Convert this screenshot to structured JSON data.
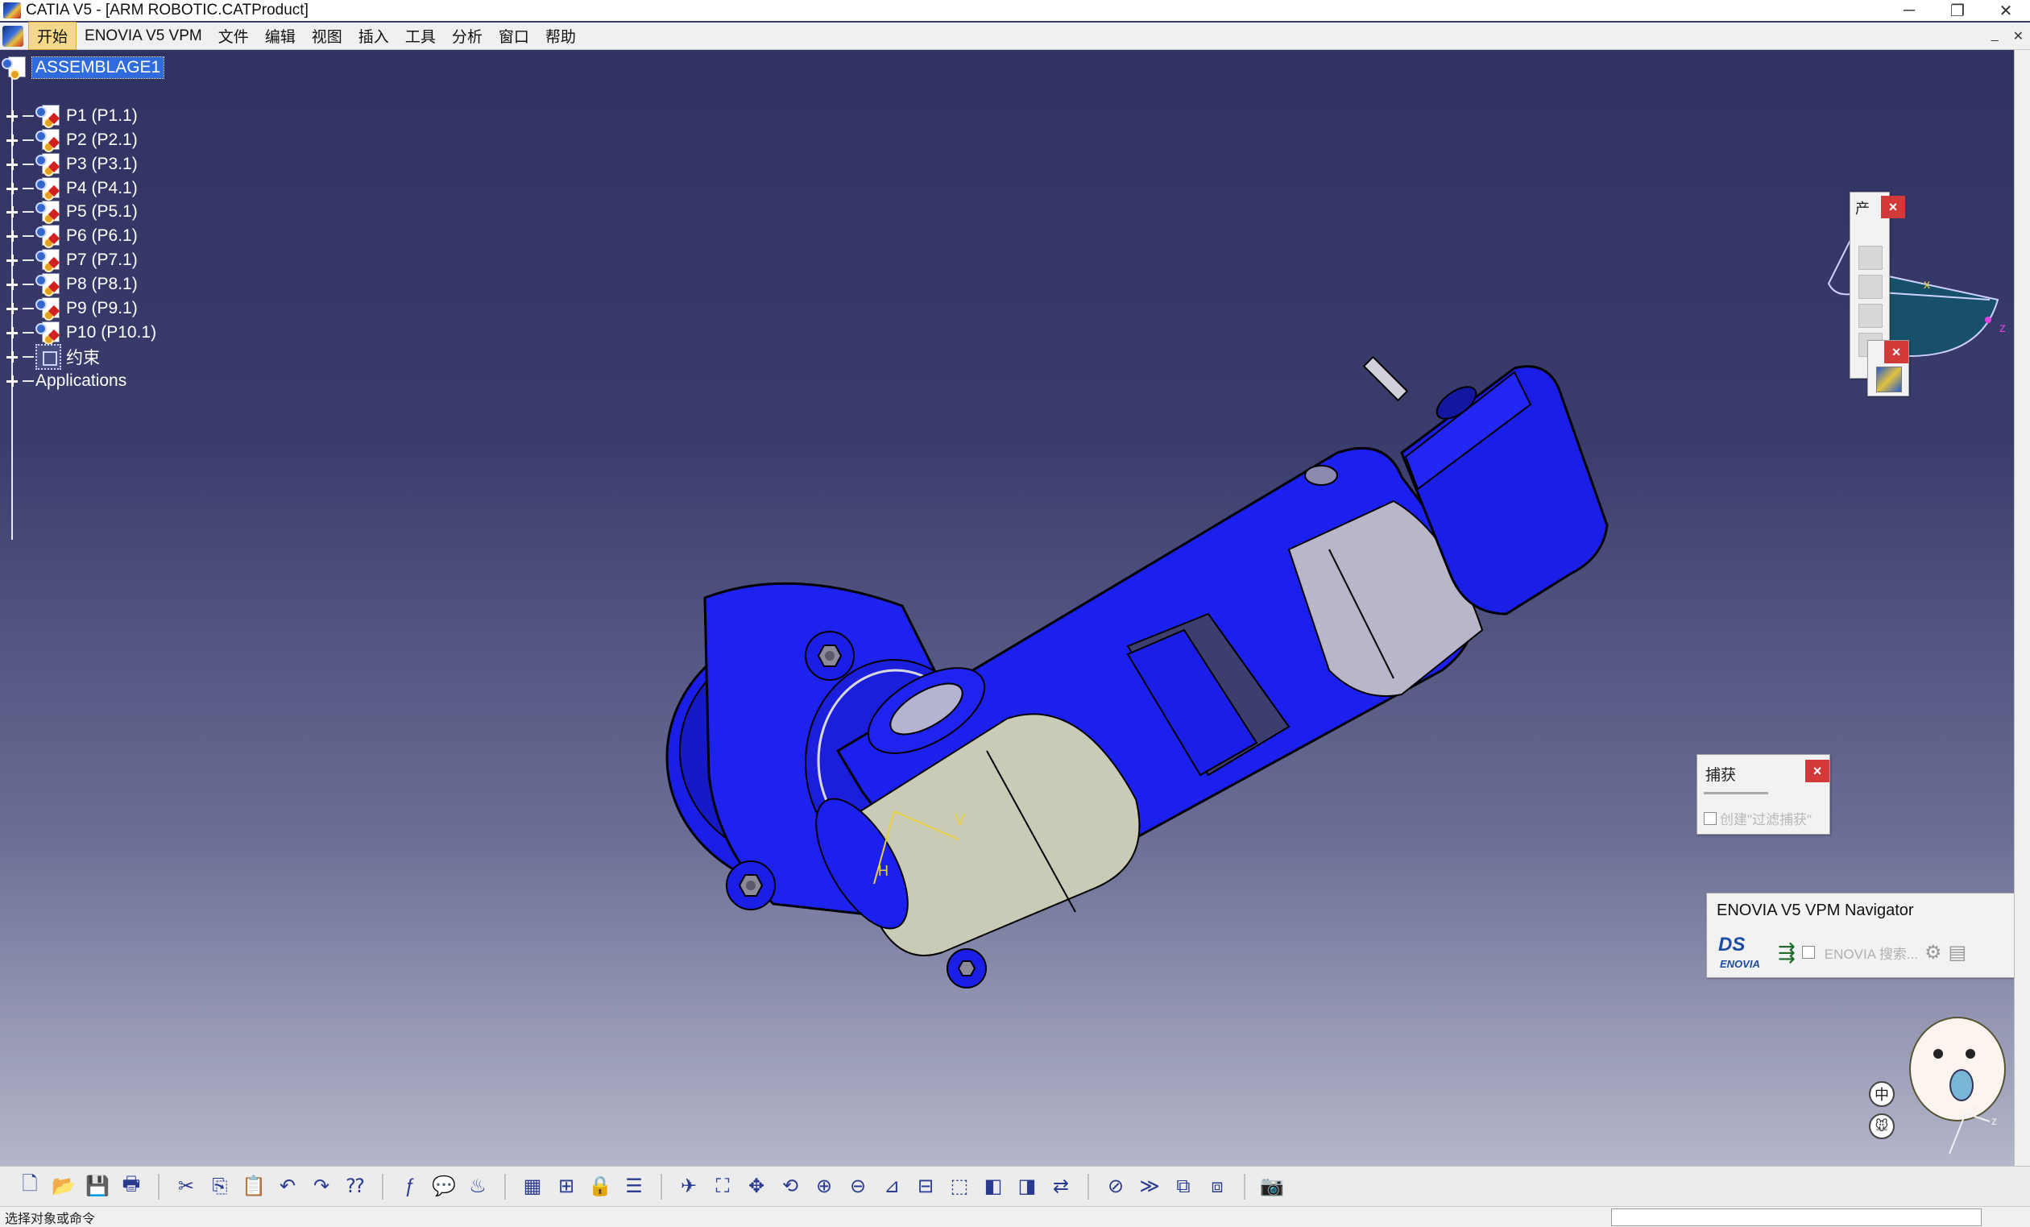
{
  "window": {
    "title": "CATIA V5 - [ARM ROBOTIC.CATProduct]",
    "minimize_glyph": "─",
    "restore_glyph": "❐",
    "close_glyph": "✕"
  },
  "menu": {
    "items": [
      "开始",
      "ENOVIA V5 VPM",
      "文件",
      "编辑",
      "视图",
      "插入",
      "工具",
      "分析",
      "窗口",
      "帮助"
    ],
    "active_index": 0,
    "right_glyphs": [
      "_",
      "✕"
    ]
  },
  "tree": {
    "root": "ASSEMBLAGE1",
    "parts": [
      "P1 (P1.1)",
      "P2 (P2.1)",
      "P3 (P3.1)",
      "P4 (P4.1)",
      "P5 (P5.1)",
      "P6 (P6.1)",
      "P7 (P7.1)",
      "P8 (P8.1)",
      "P9 (P9.1)",
      "P10 (P10.1)"
    ],
    "constraints": "约束",
    "applications": "Applications"
  },
  "compass": {
    "x_label": "x",
    "z_label": "z"
  },
  "axis_triad": {
    "x_label": "x",
    "z_label": "z"
  },
  "model_labels": {
    "v": "V",
    "h": "H"
  },
  "capture_panel": {
    "title": "捕获",
    "checkbox_label": "创建\"过滤捕获\"",
    "close_glyph": "×"
  },
  "enovia_panel": {
    "title": "ENOVIA V5 VPM Navigator",
    "logo_ds": "DS",
    "logo_text": "ENOVIA",
    "search_label": "ENOVIA 搜索..."
  },
  "small_panels": {
    "close_glyph": "×",
    "title_char": "产"
  },
  "ime": {
    "mode": "中",
    "extra": "🐭"
  },
  "toolbar": {
    "icons": [
      "new-icon",
      "open-icon",
      "save-icon",
      "print-icon",
      "sep",
      "cut-icon",
      "copy-icon",
      "paste-icon",
      "undo-icon",
      "redo-icon",
      "whats-this-icon",
      "sep",
      "formula-icon",
      "comment-icon",
      "light-icon",
      "sep",
      "table-icon",
      "tree-icon",
      "lock-icon",
      "properties-icon",
      "sep",
      "fly-icon",
      "fit-all-icon",
      "pan-icon",
      "rotate-icon",
      "zoom-in-icon",
      "zoom-out-icon",
      "normal-view-icon",
      "multi-view-icon",
      "iso-view-icon",
      "shading-icon",
      "hide-show-icon",
      "swap-icon",
      "sep",
      "deactivate-icon",
      "next-icon",
      "copy-view-icon",
      "paste-view-icon",
      "sep",
      "capture-icon"
    ],
    "glyphs": {
      "new-icon": "🗋",
      "open-icon": "📂",
      "save-icon": "💾",
      "print-icon": "🖶",
      "cut-icon": "✂",
      "copy-icon": "⎘",
      "paste-icon": "📋",
      "undo-icon": "↶",
      "redo-icon": "↷",
      "whats-this-icon": "⁇",
      "formula-icon": "ƒ",
      "comment-icon": "💬",
      "light-icon": "♨",
      "table-icon": "▦",
      "tree-icon": "⊞",
      "lock-icon": "🔒",
      "properties-icon": "☰",
      "fly-icon": "✈",
      "fit-all-icon": "⛶",
      "pan-icon": "✥",
      "rotate-icon": "⟲",
      "zoom-in-icon": "⊕",
      "zoom-out-icon": "⊖",
      "normal-view-icon": "⊿",
      "multi-view-icon": "⊟",
      "iso-view-icon": "⬚",
      "shading-icon": "◧",
      "hide-show-icon": "◨",
      "swap-icon": "⇄",
      "deactivate-icon": "⊘",
      "next-icon": "≫",
      "copy-view-icon": "⧉",
      "paste-view-icon": "⧈",
      "capture-icon": "📷"
    }
  },
  "status": {
    "text": "选择对象或命令"
  },
  "colors": {
    "part_blue": "#1a1ee6",
    "part_dark": "#0a0c9a",
    "cylinder": "#c9cbb6",
    "roller": "#b9b6c9",
    "accent": "#2f6bdc"
  }
}
